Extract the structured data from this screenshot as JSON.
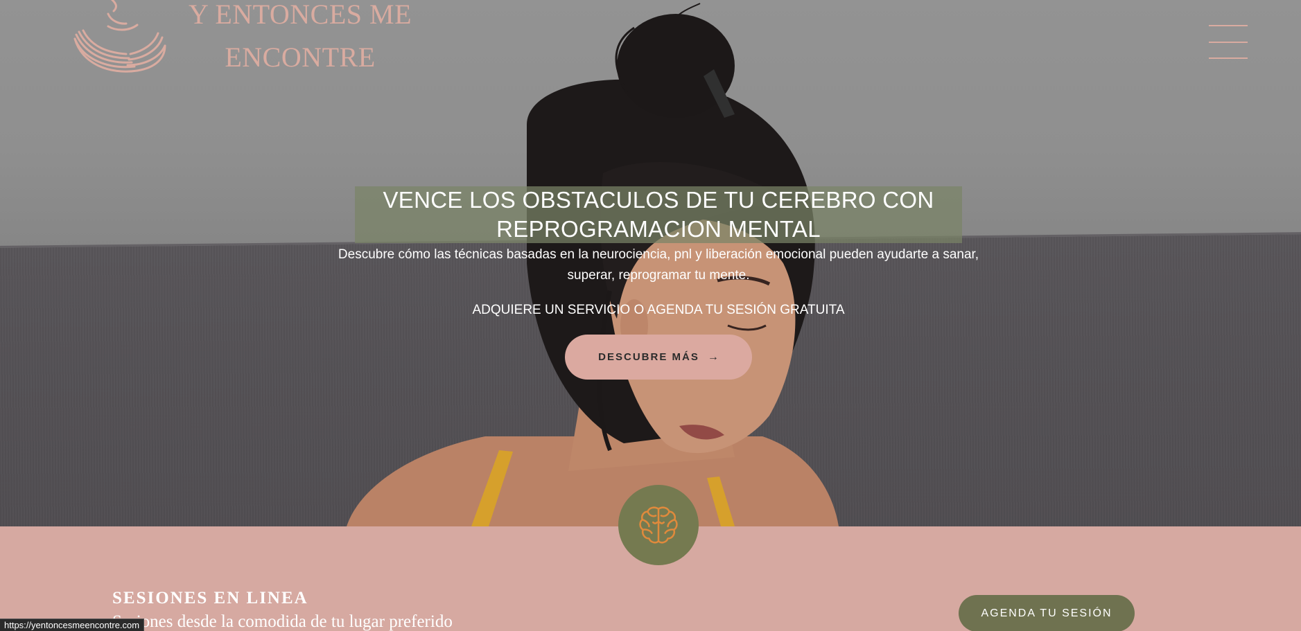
{
  "brand": {
    "line1": "Y ENTONCES ME",
    "line2": "ENCONTRE",
    "color": "#d9aba0"
  },
  "nav": {
    "menu_icon": "hamburger-menu-icon"
  },
  "hero": {
    "headline": "VENCE LOS OBSTACULOS DE TU CEREBRO CON REPROGRAMACION MENTAL",
    "subtext": "Descubre cómo las técnicas basadas en la neurociencia, pnl y liberación emocional pueden ayudarte a sanar, superar, reprogramar tu mente.",
    "cta_text": "ADQUIERE UN SERVICIO O AGENDA TU SESIÓN GRATUITA",
    "button_label": "DESCUBRE MÁS",
    "button_arrow": "→",
    "headline_bg": "#7a8467",
    "button_bg": "#dba9a0"
  },
  "feature": {
    "icon": "brain-icon",
    "circle_color": "#757a50",
    "icon_color": "#e08a3c"
  },
  "sessions": {
    "title": "SESIONES EN LINEA",
    "subtitle": "Sesiones desde la comodida de tu lugar preferido",
    "button_label": "AGENDA TU SESIÓN",
    "button_bg": "#6f7250",
    "section_bg": "#d6a9a1"
  },
  "status_bar": {
    "url": "https://yentoncesmeencontre.com"
  }
}
